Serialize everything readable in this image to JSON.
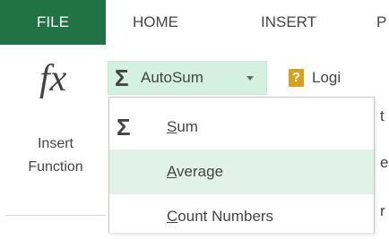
{
  "tabs": {
    "file": "FILE",
    "home": "HOME",
    "insert": "INSERT",
    "partial": "P"
  },
  "insert_function": {
    "icon_glyph": "fx",
    "label_line1": "Insert",
    "label_line2": "Function"
  },
  "autosum": {
    "icon": "sigma-icon",
    "label": "AutoSum"
  },
  "logical": {
    "icon": "logical-icon",
    "glyph": "?",
    "label": "Logi"
  },
  "dropdown": {
    "items": [
      {
        "key": "S",
        "rest": "um",
        "selected": false
      },
      {
        "key": "A",
        "rest": "verage",
        "selected": true
      },
      {
        "key": "C",
        "rest": "ount Numbers",
        "selected": false
      }
    ]
  },
  "peek_text": [
    "t",
    "e",
    "r"
  ],
  "colors": {
    "file_tab": "#217346",
    "autosum_hover": "#d3f0e0",
    "menu_selected": "#e1f3e8",
    "logical_icon": "#d9a01e",
    "text": "#444444"
  }
}
